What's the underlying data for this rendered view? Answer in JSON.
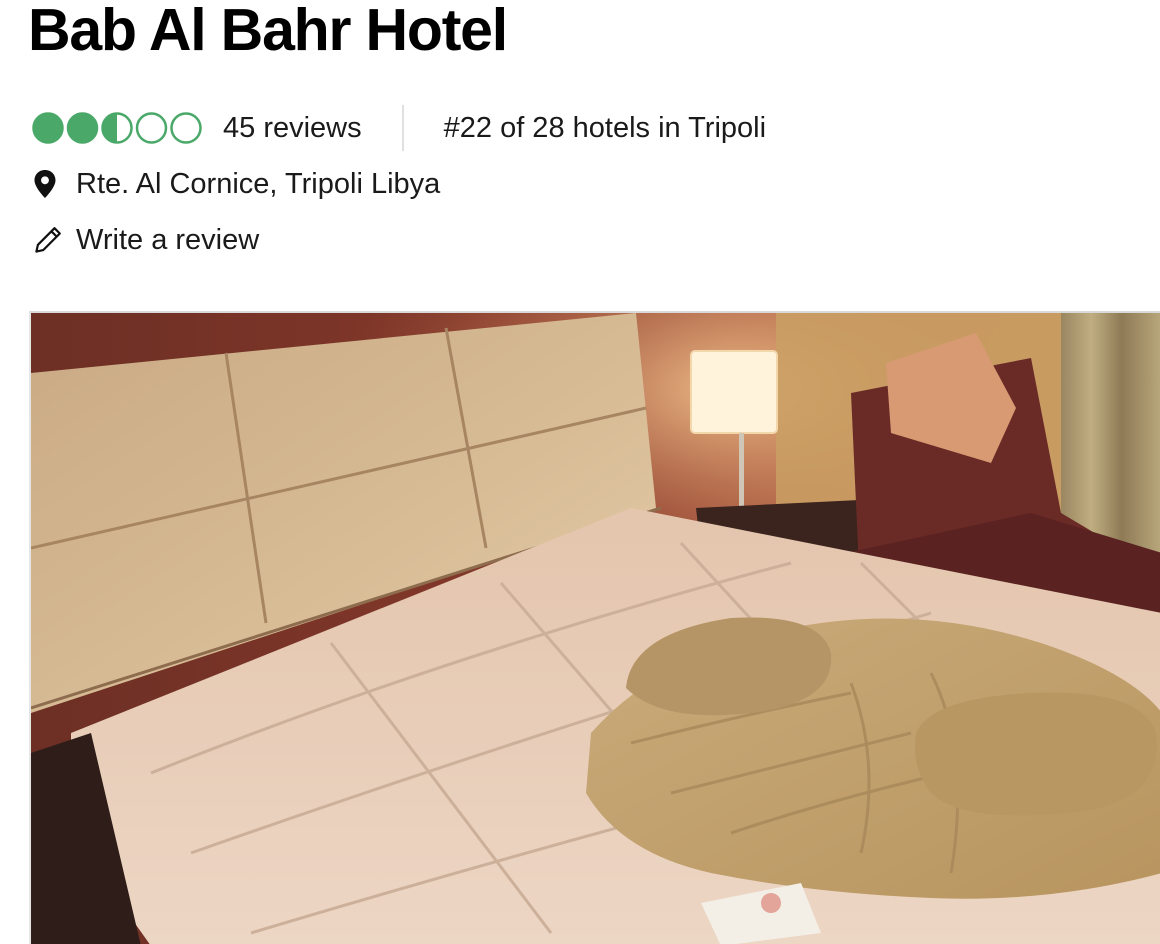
{
  "hotel": {
    "name": "Bab Al Bahr Hotel",
    "rating": {
      "value": 2.5,
      "max": 5,
      "bubble_color": "#4aa869"
    },
    "review_count": "45 reviews",
    "ranking": "#22 of 28 hotels in Tripoli",
    "address": "Rte. Al Cornice, Tripoli Libya",
    "write_review_label": "Write a review"
  },
  "icons": {
    "location": "map-pin-icon",
    "write": "pencil-icon"
  },
  "photo": {
    "subject": "hotel-room-photo"
  }
}
